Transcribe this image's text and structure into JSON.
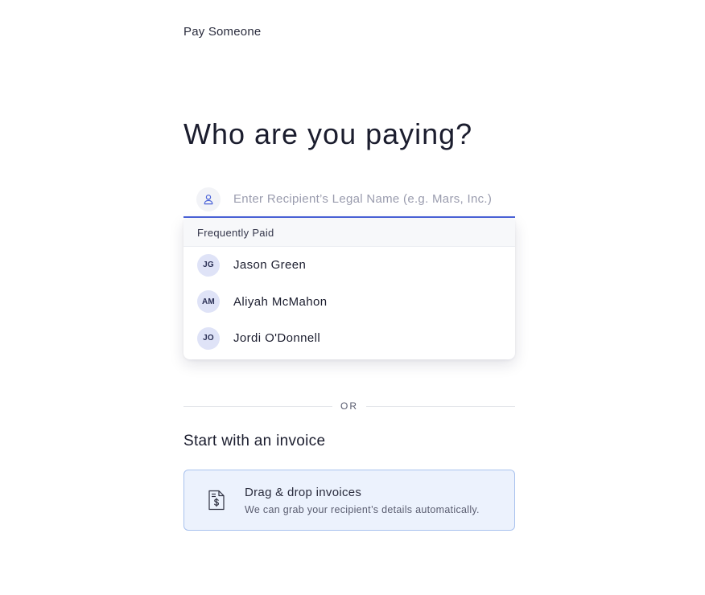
{
  "breadcrumb": "Pay Someone",
  "title": "Who are you paying?",
  "search": {
    "placeholder": "Enter Recipient’s Legal Name (e.g. Mars, Inc.)",
    "value": "",
    "icon": "person-icon"
  },
  "dropdown": {
    "header": "Frequently Paid",
    "items": [
      {
        "initials": "JG",
        "name": "Jason Green"
      },
      {
        "initials": "AM",
        "name": "Aliyah McMahon"
      },
      {
        "initials": "JO",
        "name": "Jordi O'Donnell"
      }
    ]
  },
  "divider_text": "OR",
  "invoice_section": {
    "title": "Start with an invoice",
    "dropzone_title": "Drag & drop invoices",
    "dropzone_subtitle": "We can grab your recipient’s details automatically.",
    "icon": "invoice-dollar-icon"
  },
  "colors": {
    "accent": "#4a62d8",
    "dropzone_bg": "#ecf2fd",
    "dropzone_border": "#a9c2ee",
    "avatar_bg": "#dfe3f7"
  }
}
